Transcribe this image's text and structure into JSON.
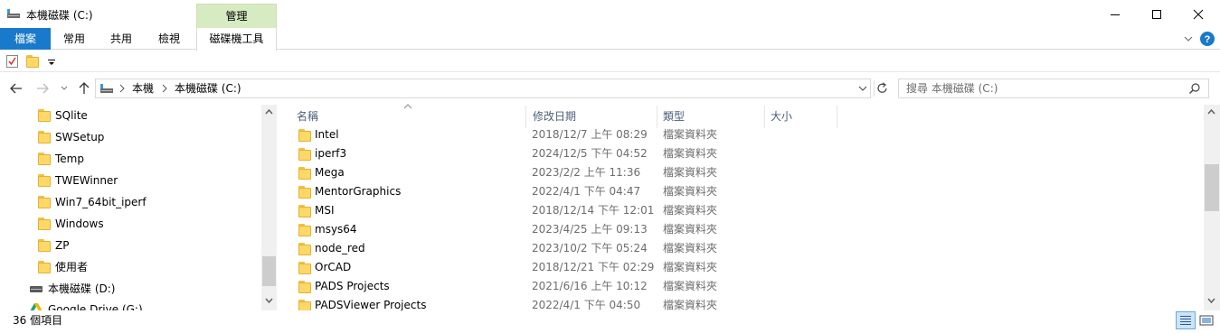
{
  "window": {
    "title": "本機磁碟 (C:)",
    "contextual_tab_group": "管理",
    "minimize_icon": "minimize-icon",
    "maximize_icon": "maximize-icon",
    "close_icon": "close-icon"
  },
  "ribbon": {
    "tabs": [
      {
        "label": "檔案"
      },
      {
        "label": "常用"
      },
      {
        "label": "共用"
      },
      {
        "label": "檢視"
      },
      {
        "label": "磁碟機工具"
      }
    ],
    "accent": "#1979ca",
    "contextual_color": "#d6ebc2"
  },
  "address": {
    "crumbs": [
      "本機",
      "本機磁碟 (C:)"
    ],
    "search_placeholder": "搜尋 本機磁碟 (C:)"
  },
  "nav": {
    "items": [
      {
        "label": "SQlite"
      },
      {
        "label": "SWSetup"
      },
      {
        "label": "Temp"
      },
      {
        "label": "TWEWinner"
      },
      {
        "label": "Win7_64bit_iperf"
      },
      {
        "label": "Windows"
      },
      {
        "label": "ZP"
      },
      {
        "label": "使用者"
      }
    ],
    "drive": "本機磁碟 (D:)",
    "cloud": "Google Drive (G:)"
  },
  "columns": {
    "name": "名稱",
    "date": "修改日期",
    "type": "類型",
    "size": "大小"
  },
  "files": [
    {
      "name": "Intel",
      "date": "2018/12/7 上午 08:29",
      "type": "檔案資料夾"
    },
    {
      "name": "iperf3",
      "date": "2024/12/5 下午 04:52",
      "type": "檔案資料夾"
    },
    {
      "name": "Mega",
      "date": "2023/2/2 上午 11:36",
      "type": "檔案資料夾"
    },
    {
      "name": "MentorGraphics",
      "date": "2022/4/1 下午 04:47",
      "type": "檔案資料夾"
    },
    {
      "name": "MSI",
      "date": "2018/12/14 下午 12:01",
      "type": "檔案資料夾"
    },
    {
      "name": "msys64",
      "date": "2023/4/25 上午 09:13",
      "type": "檔案資料夾"
    },
    {
      "name": "node_red",
      "date": "2023/10/2 下午 05:24",
      "type": "檔案資料夾"
    },
    {
      "name": "OrCAD",
      "date": "2018/12/21 下午 02:29",
      "type": "檔案資料夾"
    },
    {
      "name": "PADS Projects",
      "date": "2021/6/16 上午 10:12",
      "type": "檔案資料夾"
    },
    {
      "name": "PADSViewer Projects",
      "date": "2022/4/1 下午 04:50",
      "type": "檔案資料夾"
    }
  ],
  "status": {
    "item_count": "36 個項目"
  }
}
